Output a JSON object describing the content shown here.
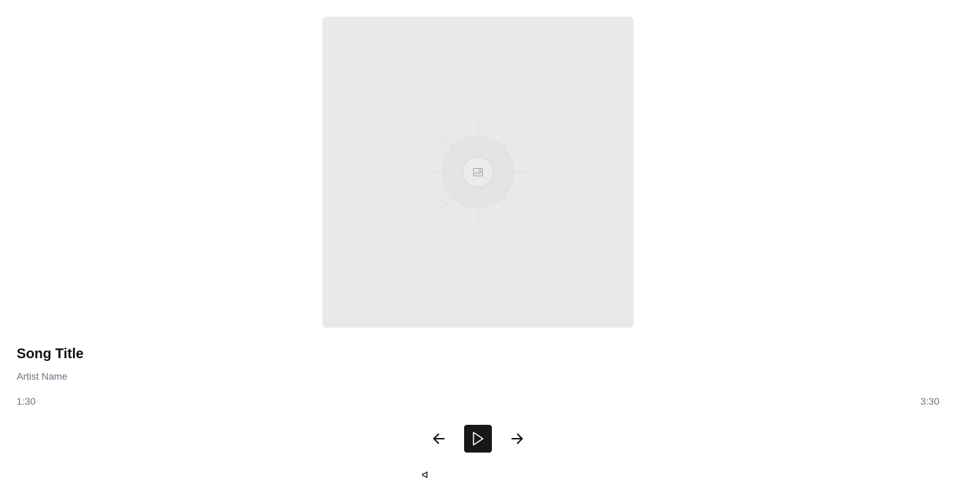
{
  "track": {
    "title": "Song Title",
    "artist": "Artist Name"
  },
  "progress": {
    "current_time": "1:30",
    "total_time": "3:30"
  },
  "controls": {
    "previous_icon": "arrow-left-icon",
    "play_icon": "play-icon",
    "next_icon": "arrow-right-icon",
    "volume_icon": "volume-icon"
  },
  "artwork": {
    "placeholder_icon": "image-icon"
  },
  "colors": {
    "artwork_background": "#e9e9e9",
    "play_button_background": "#18181b",
    "muted_text": "#6b7280"
  }
}
